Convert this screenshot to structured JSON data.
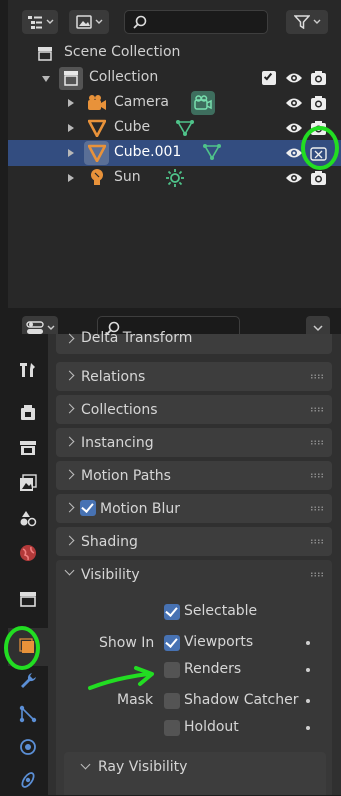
{
  "outliner": {
    "search_placeholder": "",
    "rows": [
      {
        "label": "Scene Collection"
      },
      {
        "label": "Collection"
      },
      {
        "label": "Camera"
      },
      {
        "label": "Cube"
      },
      {
        "label": "Cube.001"
      },
      {
        "label": "Sun"
      }
    ]
  },
  "properties": {
    "search_placeholder": "",
    "panels": {
      "delta_transform": "Delta Transform",
      "relations": "Relations",
      "collections": "Collections",
      "instancing": "Instancing",
      "motion_paths": "Motion Paths",
      "motion_blur": "Motion Blur",
      "shading": "Shading",
      "visibility": "Visibility",
      "ray_visibility": "Ray Visibility"
    },
    "visibility": {
      "selectable": "Selectable",
      "show_in": "Show In",
      "viewports": "Viewports",
      "renders": "Renders",
      "mask": "Mask",
      "shadow_catcher": "Shadow Catcher",
      "holdout": "Holdout"
    }
  },
  "colors": {
    "selection": "#334d80",
    "accent_blue": "#4772b3",
    "object_orange": "#e8923a",
    "mesh_green": "#4fc38a",
    "annotation_green": "#22dd22"
  }
}
